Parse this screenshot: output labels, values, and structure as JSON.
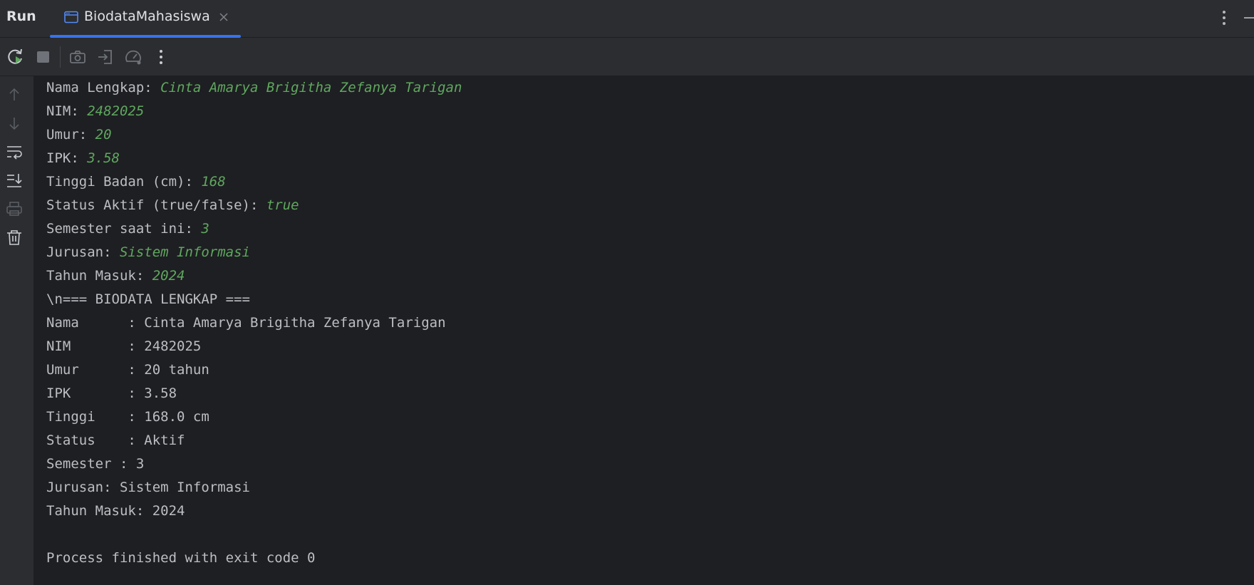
{
  "header": {
    "run_label": "Run",
    "tab_label": "BiodataMahasiswa"
  },
  "colors": {
    "accent": "#3574f0",
    "input_text": "#5fa85f",
    "console_text": "#bcbec4"
  },
  "toolbar": {
    "buttons": [
      "rerun-icon",
      "stop-icon",
      "camera-icon",
      "login-icon",
      "speedometer-icon",
      "more-vertical-icon"
    ]
  },
  "gutter": {
    "buttons": [
      "arrow-up-icon",
      "arrow-down-icon",
      "soft-wrap-icon",
      "scroll-to-end-icon",
      "print-icon",
      "trash-icon"
    ]
  },
  "console": {
    "prompts": [
      {
        "label": "Nama Lengkap: ",
        "input": "Cinta Amarya Brigitha Zefanya Tarigan"
      },
      {
        "label": "NIM: ",
        "input": "2482025"
      },
      {
        "label": "Umur: ",
        "input": "20"
      },
      {
        "label": "IPK: ",
        "input": "3.58"
      },
      {
        "label": "Tinggi Badan (cm): ",
        "input": "168"
      },
      {
        "label": "Status Aktif (true/false): ",
        "input": "true"
      },
      {
        "label": "Semester saat ini: ",
        "input": "3"
      },
      {
        "label": "Jurusan: ",
        "input": "Sistem Informasi"
      },
      {
        "label": "Tahun Masuk: ",
        "input": "2024"
      }
    ],
    "output": [
      "\\n=== BIODATA LENGKAP ===",
      "Nama      : Cinta Amarya Brigitha Zefanya Tarigan",
      "NIM       : 2482025",
      "Umur      : 20 tahun",
      "IPK       : 3.58",
      "Tinggi    : 168.0 cm",
      "Status    : Aktif",
      "Semester : 3",
      "Jurusan: Sistem Informasi",
      "Tahun Masuk: 2024"
    ],
    "exit_message": "Process finished with exit code 0"
  }
}
